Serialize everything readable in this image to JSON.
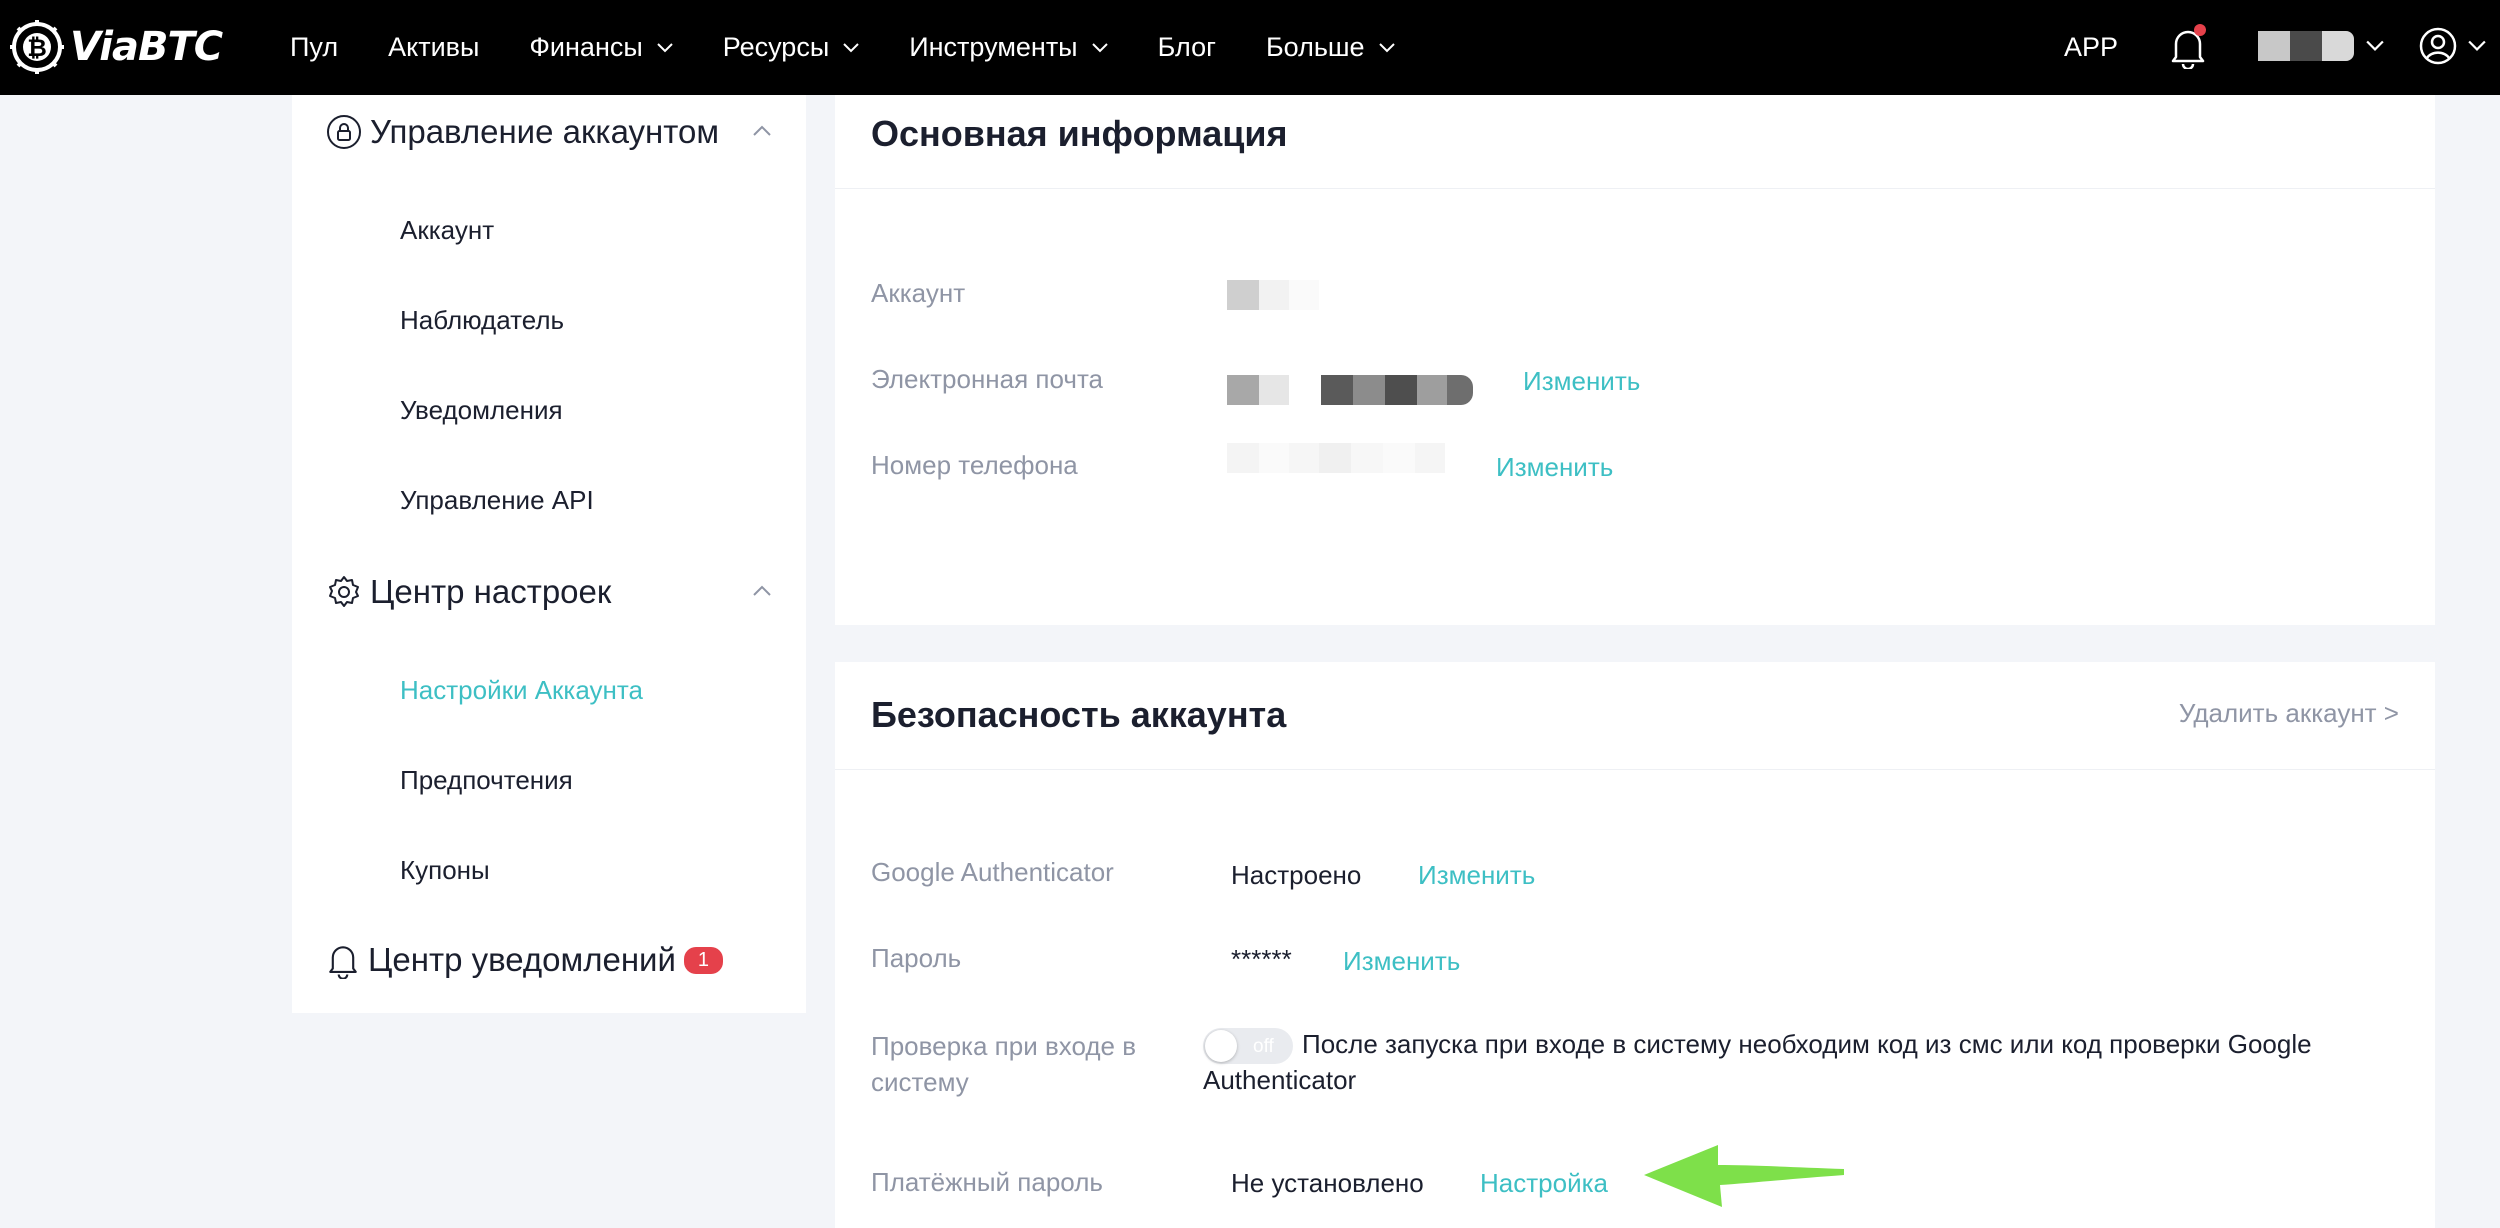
{
  "brand": {
    "name": "ViaBTC"
  },
  "nav": {
    "items": [
      {
        "label": "Пул",
        "dropdown": false
      },
      {
        "label": "Активы",
        "dropdown": false
      },
      {
        "label": "Финансы",
        "dropdown": true
      },
      {
        "label": "Ресурсы",
        "dropdown": true
      },
      {
        "label": "Инструменты",
        "dropdown": true
      },
      {
        "label": "Блог",
        "dropdown": false
      },
      {
        "label": "Больше",
        "dropdown": true
      }
    ],
    "app": "APP",
    "icons": {
      "notifications": "bell-icon",
      "user": "user-circle-icon"
    }
  },
  "sidebar": {
    "account_management": {
      "title": "Управление аккаунтом",
      "icon": "lock-icon",
      "items": [
        "Аккаунт",
        "Наблюдатель",
        "Уведомления",
        "Управление API"
      ]
    },
    "settings_center": {
      "title": "Центр настроек",
      "icon": "gear-icon",
      "items": [
        "Настройки Аккаунта",
        "Предпочтения",
        "Купоны"
      ],
      "active": "Настройки Аккаунта"
    },
    "notification_center": {
      "title": "Центр уведомлений",
      "icon": "bell-icon",
      "badge": "1"
    }
  },
  "basic_info": {
    "title": "Основная информация",
    "rows": {
      "account": {
        "label": "Аккаунт"
      },
      "email": {
        "label": "Электронная почта",
        "action": "Изменить"
      },
      "phone": {
        "label": "Номер телефона",
        "action": "Изменить"
      }
    }
  },
  "security": {
    "title": "Безопасность аккаунта",
    "delete_link": "Удалить аккаунт >",
    "rows": {
      "google_auth": {
        "label": "Google Authenticator",
        "value": "Настроено",
        "action": "Изменить"
      },
      "password": {
        "label": "Пароль",
        "value": "******",
        "action": "Изменить"
      },
      "login_check": {
        "label": "Проверка при входе в систему",
        "toggle_state": "off",
        "description": "После запуска при входе в систему необходим код из смс или код проверки Google Authenticator"
      },
      "payment_password": {
        "label": "Платёжный пароль",
        "value": "Не установлено",
        "action": "Настройка"
      }
    }
  },
  "colors": {
    "accent": "#3dbfc4",
    "badge": "#e5414b",
    "annotation_arrow": "#7ee04a"
  }
}
